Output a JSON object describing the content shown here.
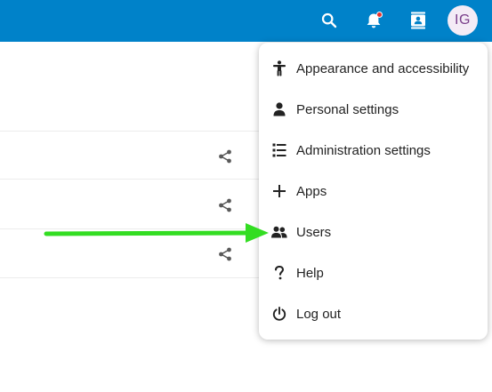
{
  "header": {
    "background": "#0082c9",
    "search_icon": "search-icon",
    "notifications_icon": "bell-icon",
    "contacts_icon": "contacts-icon",
    "notification_dot_color": "#e9322d",
    "avatar": {
      "initials": "IG",
      "background": "#f4ecf6",
      "color": "#7a3f8a"
    }
  },
  "list": {
    "rows": [
      {
        "icon": "share-icon"
      },
      {
        "icon": "share-icon"
      },
      {
        "icon": "share-icon"
      }
    ]
  },
  "menu": {
    "items": [
      {
        "icon": "accessibility-icon",
        "label": "Appearance and accessibility"
      },
      {
        "icon": "person-icon",
        "label": "Personal settings"
      },
      {
        "icon": "list-icon",
        "label": "Administration settings"
      },
      {
        "icon": "plus-icon",
        "label": "Apps"
      },
      {
        "icon": "users-icon",
        "label": "Users"
      },
      {
        "icon": "help-icon",
        "label": "Help"
      },
      {
        "icon": "power-icon",
        "label": "Log out"
      }
    ]
  },
  "annotation": {
    "type": "arrow",
    "color": "#33dd22",
    "points_to": "Users"
  }
}
